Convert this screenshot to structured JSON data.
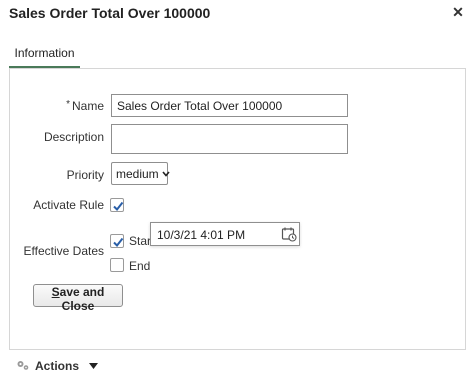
{
  "dialog": {
    "title": "Sales Order Total Over 100000",
    "close_glyph": "✕"
  },
  "tabs": [
    {
      "label": "Information",
      "selected": true
    }
  ],
  "form": {
    "required_marker": "*",
    "name_label": "Name",
    "name_value": "Sales Order Total Over 100000",
    "description_label": "Description",
    "description_value": "",
    "priority_label": "Priority",
    "priority_value": "medium",
    "activate_label": "Activate Rule",
    "activate_checked": true,
    "effective_dates_label": "Effective Dates",
    "start_label": "Start",
    "start_checked": true,
    "start_value": "10/3/21 4:01 PM",
    "end_label": "End",
    "end_checked": false
  },
  "buttons": {
    "save_close_mnemonic": "S",
    "save_close_rest": "ave and Close"
  },
  "footer": {
    "actions_label": "Actions",
    "actions_icon": "gears-icon"
  },
  "colors": {
    "tab_underline": "#4a7a59",
    "border": "#d6d6d6"
  }
}
